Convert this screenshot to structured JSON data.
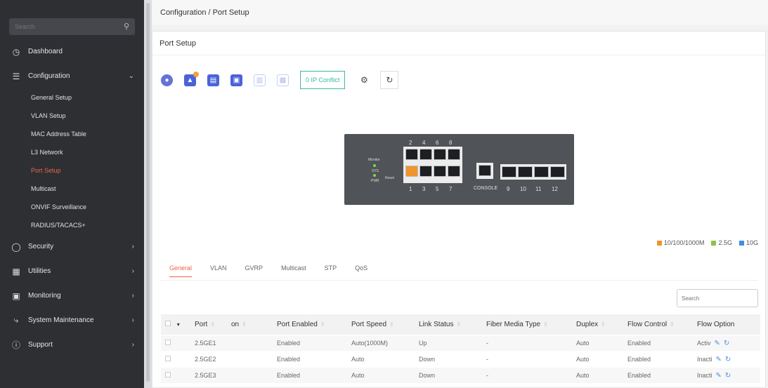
{
  "sidebar": {
    "search_placeholder": "Search",
    "search_icon": "search-icon",
    "items": [
      {
        "label": "Dashboard",
        "icon": "dashboard-icon"
      },
      {
        "label": "Configuration",
        "icon": "configuration-icon",
        "expanded": true
      },
      {
        "label": "Security",
        "icon": "shield-icon"
      },
      {
        "label": "Utilities",
        "icon": "grid-icon"
      },
      {
        "label": "Monitoring",
        "icon": "monitor-icon"
      },
      {
        "label": "System Maintenance",
        "icon": "wrench-icon"
      },
      {
        "label": "Support",
        "icon": "help-icon"
      }
    ],
    "config_sub": [
      "General Setup",
      "VLAN Setup",
      "MAC Address Table",
      "L3 Network",
      "Port Setup",
      "Multicast",
      "ONVIF Surveillance",
      "RADIUS/TACACS+"
    ],
    "active_sub": "Port Setup",
    "active_color": "#e8664c"
  },
  "breadcrumb": "Configuration / Port Setup",
  "card_title": "Port Setup",
  "toolbar": {
    "ip_conflict": "0 IP Conflict"
  },
  "switch": {
    "top_numbers": [
      "2",
      "4",
      "6",
      "8"
    ],
    "bottom_numbers": [
      "1",
      "3",
      "5",
      "7"
    ],
    "sfp_numbers": [
      "9",
      "10",
      "11",
      "12"
    ],
    "console": "CONSOLE",
    "monitor": "Monitor",
    "sys": "SYS",
    "pwr": "PWR",
    "reset": "Reset",
    "active_port": "1"
  },
  "legend": [
    {
      "label": "10/100/1000M",
      "color": "#f0952b"
    },
    {
      "label": "2.5G",
      "color": "#8bc34a"
    },
    {
      "label": "10G",
      "color": "#3d8fe6"
    }
  ],
  "tabs": [
    "General",
    "VLAN",
    "GVRP",
    "Multicast",
    "STP",
    "QoS"
  ],
  "active_tab": "General",
  "table": {
    "search_placeholder": "Search",
    "columns": [
      "Port",
      "on",
      "Port Enabled",
      "Port Speed",
      "Link Status",
      "Fiber Media Type",
      "Duplex",
      "Flow Control",
      "Flow Option"
    ],
    "rows": [
      {
        "port": "2.5GE1",
        "on": "",
        "enabled": "Enabled",
        "speed": "Auto(1000M)",
        "link": "Up",
        "fiber": "-",
        "duplex": "Auto",
        "flow": "Enabled",
        "option": "Activ"
      },
      {
        "port": "2.5GE2",
        "on": "",
        "enabled": "Enabled",
        "speed": "Auto",
        "link": "Down",
        "fiber": "-",
        "duplex": "Auto",
        "flow": "Enabled",
        "option": "Inacti"
      },
      {
        "port": "2.5GE3",
        "on": "",
        "enabled": "Enabled",
        "speed": "Auto",
        "link": "Down",
        "fiber": "-",
        "duplex": "Auto",
        "flow": "Enabled",
        "option": "Inacti"
      }
    ]
  }
}
